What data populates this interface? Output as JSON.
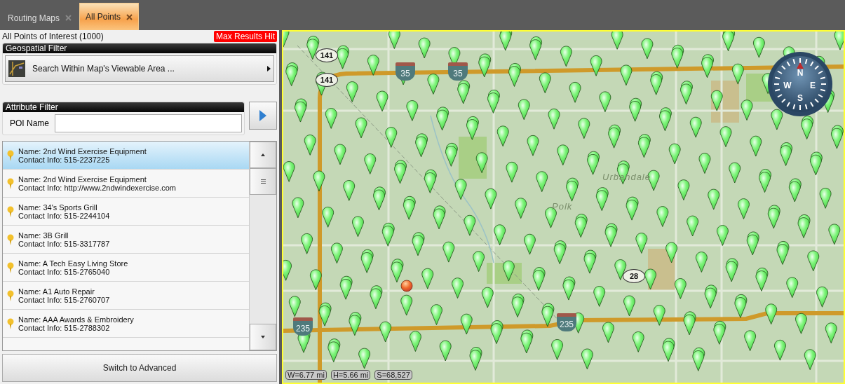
{
  "tabs": [
    {
      "label": "Routing Maps",
      "selected": false
    },
    {
      "label": "All Points",
      "selected": true
    }
  ],
  "results": {
    "title": "All Points of Interest (1000)",
    "badge": "Max Results Hit"
  },
  "geospatial_filter": {
    "header": "Geospatial Filter",
    "button": "Search  Within Map's Viewable Area ..."
  },
  "attribute_filter": {
    "header": "Attribute Filter",
    "field_label": "POI Name"
  },
  "poi_list": [
    {
      "name": "Name: 2nd Wind Exercise Equipment",
      "contact": "Contact Info: 515-2237225",
      "selected": true
    },
    {
      "name": "Name: 2nd Wind Exercise Equipment",
      "contact": "Contact Info: http://www.2ndwindexercise.com",
      "selected": false
    },
    {
      "name": "Name: 34's Sports Grill",
      "contact": "Contact Info: 515-2244104",
      "selected": false
    },
    {
      "name": "Name: 3B Grill",
      "contact": "Contact Info: 515-3317787",
      "selected": false
    },
    {
      "name": "Name: A Tech Easy Living Store",
      "contact": "Contact Info: 515-2765040",
      "selected": false
    },
    {
      "name": "Name: A1 Auto Repair",
      "contact": "Contact Info: 515-2760707",
      "selected": false
    },
    {
      "name": "Name: AAA Awards & Embroidery",
      "contact": "Contact Info: 515-2788302",
      "selected": false
    }
  ],
  "advanced_button": "Switch to Advanced",
  "map": {
    "shields": [
      {
        "kind": "state",
        "label": "141"
      },
      {
        "kind": "state",
        "label": "141"
      },
      {
        "kind": "interstate",
        "label": "35"
      },
      {
        "kind": "interstate",
        "label": "35"
      },
      {
        "kind": "interstate",
        "label": "235"
      },
      {
        "kind": "interstate",
        "label": "235"
      },
      {
        "kind": "state",
        "label": "28"
      }
    ],
    "places": [
      "Urbandale",
      "Polk"
    ],
    "compass": {
      "n": "N",
      "e": "E",
      "s": "S",
      "w": "W"
    },
    "scale": [
      "W=6.77 mi",
      "H=5.66 mi",
      "S=68,527"
    ]
  }
}
